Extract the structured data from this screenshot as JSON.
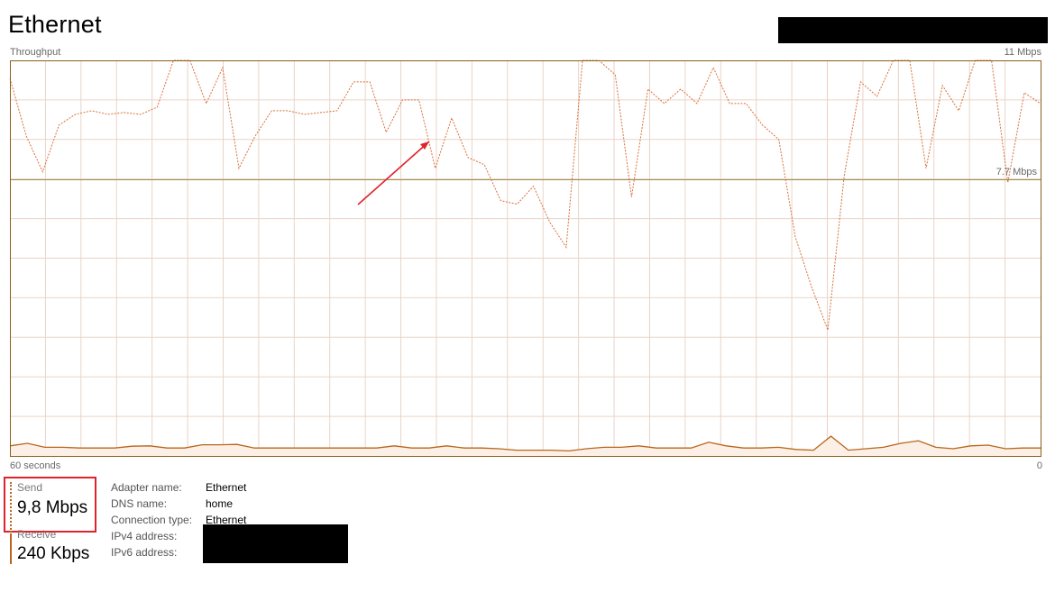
{
  "window": {
    "title": "Ethernet"
  },
  "graph": {
    "label": "Throughput",
    "max_label": "11 Mbps",
    "mid_label": "7.7 Mbps",
    "time_label": "60 seconds",
    "min_label": "0"
  },
  "chart_data": {
    "type": "line",
    "title": "",
    "ylim": [
      0,
      11
    ],
    "ytick_labels": [
      "11 Mbps",
      "7.7 Mbps",
      "0"
    ],
    "xlabel_left": "60 seconds",
    "series": [
      {
        "name": "Send",
        "style": "dashed",
        "values": [
          10.5,
          8.9,
          7.9,
          9.2,
          9.5,
          9.6,
          9.5,
          9.55,
          9.5,
          9.7,
          11.5,
          11.5,
          9.8,
          10.8,
          8.0,
          8.9,
          9.6,
          9.6,
          9.5,
          9.55,
          9.6,
          10.4,
          10.4,
          9.0,
          9.9,
          9.9,
          8.0,
          9.4,
          8.3,
          8.1,
          7.1,
          7.0,
          7.5,
          6.5,
          5.8,
          11.5,
          11.5,
          10.6,
          7.2,
          10.2,
          9.8,
          10.2,
          9.8,
          10.8,
          9.8,
          9.8,
          9.2,
          8.8,
          6.1,
          4.7,
          3.5,
          7.8,
          10.4,
          10.0,
          11.5,
          11.5,
          8.0,
          10.3,
          9.6,
          11.5,
          11.5,
          7.6,
          10.1,
          9.8
        ]
      },
      {
        "name": "Receive",
        "style": "solid",
        "values": [
          0.28,
          0.35,
          0.24,
          0.24,
          0.22,
          0.22,
          0.22,
          0.27,
          0.28,
          0.22,
          0.22,
          0.31,
          0.31,
          0.32,
          0.22,
          0.22,
          0.22,
          0.22,
          0.22,
          0.22,
          0.22,
          0.22,
          0.28,
          0.22,
          0.22,
          0.28,
          0.22,
          0.22,
          0.2,
          0.16,
          0.16,
          0.16,
          0.14,
          0.2,
          0.24,
          0.24,
          0.28,
          0.22,
          0.22,
          0.22,
          0.38,
          0.28,
          0.22,
          0.22,
          0.24,
          0.18,
          0.16,
          0.55,
          0.16,
          0.2,
          0.24,
          0.35,
          0.42,
          0.24,
          0.2,
          0.28,
          0.3,
          0.2,
          0.22,
          0.22
        ]
      }
    ],
    "colors": {
      "line": "#c8642d",
      "grid": "#ead4c8",
      "border": "#8b5f1d",
      "fill": "#fbefe6"
    },
    "grid": true
  },
  "stats": {
    "send": {
      "label": "Send",
      "value": "9,8 Mbps"
    },
    "receive": {
      "label": "Receive",
      "value": "240 Kbps"
    }
  },
  "details": [
    {
      "label": "Adapter name:",
      "value": "Ethernet"
    },
    {
      "label": "DNS name:",
      "value": "home"
    },
    {
      "label": "Connection type:",
      "value": "Ethernet"
    },
    {
      "label": "IPv4 address:",
      "value": ""
    },
    {
      "label": "IPv6 address:",
      "value": ""
    }
  ],
  "annotation": {
    "color": "#e0232b"
  }
}
